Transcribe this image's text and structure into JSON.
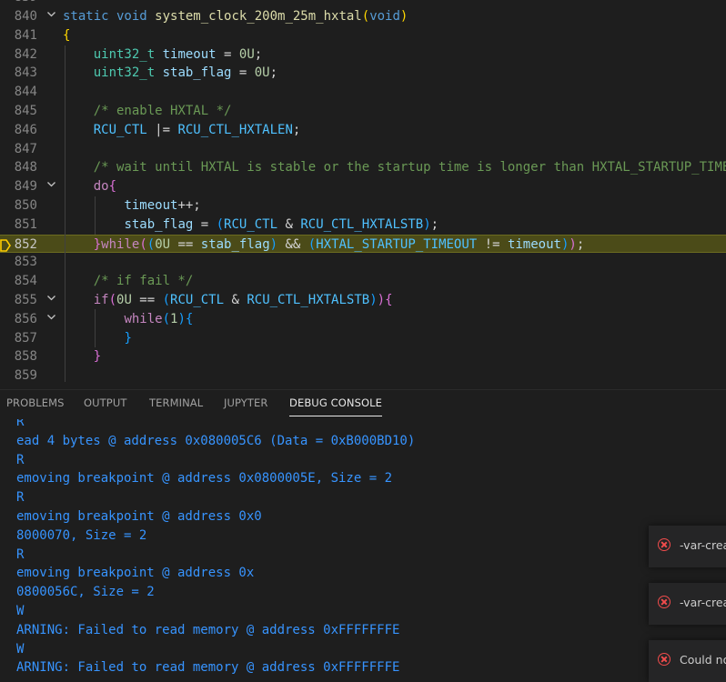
{
  "editor": {
    "top_partial_line_number": "839",
    "lines": [
      {
        "num": "840",
        "fold": "v",
        "tokens": [
          [
            "kw",
            "static"
          ],
          [
            "",
            ""
          ],
          [
            "kw",
            " void"
          ],
          [
            "fn",
            " system_clock_200m_25m_hxtal"
          ],
          [
            "br1",
            "("
          ],
          [
            "kw",
            "void"
          ],
          [
            "br1",
            ")"
          ]
        ]
      },
      {
        "num": "841",
        "fold": "",
        "tokens": [
          [
            "br1",
            "{"
          ]
        ]
      },
      {
        "num": "842",
        "fold": "",
        "tokens": [
          [
            "",
            "    "
          ],
          [
            "ty",
            "uint32_t"
          ],
          [
            "var",
            " timeout"
          ],
          [
            "",
            " = "
          ],
          [
            "num",
            "0U"
          ],
          [
            "",
            ";"
          ]
        ]
      },
      {
        "num": "843",
        "fold": "",
        "tokens": [
          [
            "",
            "    "
          ],
          [
            "ty",
            "uint32_t"
          ],
          [
            "var",
            " stab_flag"
          ],
          [
            "",
            " = "
          ],
          [
            "num",
            "0U"
          ],
          [
            "",
            ";"
          ]
        ]
      },
      {
        "num": "844",
        "fold": "",
        "tokens": []
      },
      {
        "num": "845",
        "fold": "",
        "tokens": [
          [
            "",
            "    "
          ],
          [
            "cmt",
            "/* enable HXTAL */"
          ]
        ]
      },
      {
        "num": "846",
        "fold": "",
        "tokens": [
          [
            "",
            "    "
          ],
          [
            "mac",
            "RCU_CTL"
          ],
          [
            "",
            " |= "
          ],
          [
            "mac",
            "RCU_CTL_HXTALEN"
          ],
          [
            "",
            ";"
          ]
        ]
      },
      {
        "num": "847",
        "fold": "",
        "tokens": []
      },
      {
        "num": "848",
        "fold": "",
        "tokens": [
          [
            "",
            "    "
          ],
          [
            "cmt",
            "/* wait until HXTAL is stable or the startup time is longer than HXTAL_STARTUP_TIMEOUT */"
          ]
        ]
      },
      {
        "num": "849",
        "fold": "v",
        "tokens": [
          [
            "",
            "    "
          ],
          [
            "kwc",
            "do"
          ],
          [
            "br2",
            "{"
          ]
        ]
      },
      {
        "num": "850",
        "fold": "",
        "tokens": [
          [
            "",
            "        "
          ],
          [
            "var",
            "timeout"
          ],
          [
            "",
            "++;"
          ]
        ]
      },
      {
        "num": "851",
        "fold": "",
        "tokens": [
          [
            "",
            "        "
          ],
          [
            "var",
            "stab_flag"
          ],
          [
            "",
            " = "
          ],
          [
            "br3",
            "("
          ],
          [
            "mac",
            "RCU_CTL"
          ],
          [
            "",
            " & "
          ],
          [
            "mac",
            "RCU_CTL_HXTALSTB"
          ],
          [
            "br3",
            ")"
          ],
          [
            "",
            ";"
          ]
        ]
      },
      {
        "num": "852",
        "fold": "",
        "current": true,
        "tokens": [
          [
            "",
            "    "
          ],
          [
            "br2",
            "}"
          ],
          [
            "kwc",
            "while"
          ],
          [
            "br2",
            "("
          ],
          [
            "br3",
            "("
          ],
          [
            "num",
            "0U"
          ],
          [
            "",
            " == "
          ],
          [
            "var",
            "stab_flag"
          ],
          [
            "br3",
            ")"
          ],
          [
            "",
            " && "
          ],
          [
            "br3",
            "("
          ],
          [
            "mac",
            "HXTAL_STARTUP_TIMEOUT"
          ],
          [
            "",
            " != "
          ],
          [
            "var",
            "timeout"
          ],
          [
            "br3",
            ")"
          ],
          [
            "br2",
            ")"
          ],
          [
            "",
            ";"
          ]
        ]
      },
      {
        "num": "853",
        "fold": "",
        "tokens": []
      },
      {
        "num": "854",
        "fold": "",
        "tokens": [
          [
            "",
            "    "
          ],
          [
            "cmt",
            "/* if fail */"
          ]
        ]
      },
      {
        "num": "855",
        "fold": "v",
        "tokens": [
          [
            "",
            "    "
          ],
          [
            "kwc",
            "if"
          ],
          [
            "br2",
            "("
          ],
          [
            "num",
            "0U"
          ],
          [
            "",
            " == "
          ],
          [
            "br3",
            "("
          ],
          [
            "mac",
            "RCU_CTL"
          ],
          [
            "",
            " & "
          ],
          [
            "mac",
            "RCU_CTL_HXTALSTB"
          ],
          [
            "br3",
            ")"
          ],
          [
            "br2",
            ")"
          ],
          [
            "br2",
            "{"
          ]
        ]
      },
      {
        "num": "856",
        "fold": "v",
        "tokens": [
          [
            "",
            "        "
          ],
          [
            "kwc",
            "while"
          ],
          [
            "br3",
            "("
          ],
          [
            "num",
            "1"
          ],
          [
            "br3",
            ")"
          ],
          [
            "br3",
            "{"
          ]
        ]
      },
      {
        "num": "857",
        "fold": "",
        "tokens": [
          [
            "",
            "        "
          ],
          [
            "br3",
            "}"
          ]
        ]
      },
      {
        "num": "858",
        "fold": "",
        "tokens": [
          [
            "",
            "    "
          ],
          [
            "br2",
            "}"
          ]
        ]
      },
      {
        "num": "859",
        "fold": "",
        "tokens": []
      }
    ]
  },
  "panel": {
    "tabs": [
      {
        "label": "PROBLEMS",
        "active": false
      },
      {
        "label": "OUTPUT",
        "active": false
      },
      {
        "label": "TERMINAL",
        "active": false
      },
      {
        "label": "JUPYTER",
        "active": false
      },
      {
        "label": "DEBUG CONSOLE",
        "active": true
      }
    ]
  },
  "console": {
    "lines": [
      "R",
      "ead 4 bytes @ address 0x080005C6 (Data = 0xB000BD10)",
      "R",
      "emoving breakpoint @ address 0x0800005E, Size = 2",
      "R",
      "emoving breakpoint @ address 0x0",
      "8000070, Size = 2",
      "R",
      "emoving breakpoint @ address 0x",
      "0800056C, Size = 2",
      "W",
      "ARNING: Failed to read memory @ address 0xFFFFFFFE",
      "W",
      "ARNING: Failed to read memory @ address 0xFFFFFFFE"
    ]
  },
  "notifications": [
    {
      "icon": "error-icon",
      "text": "-var-crea"
    },
    {
      "icon": "error-icon",
      "text": "-var-crea"
    },
    {
      "icon": "error-icon",
      "text": "Could no"
    }
  ],
  "colors": {
    "background": "#1e1e1e",
    "current_line": "#4b4b18",
    "console_text": "#3794ff",
    "error": "#f14c4c"
  }
}
